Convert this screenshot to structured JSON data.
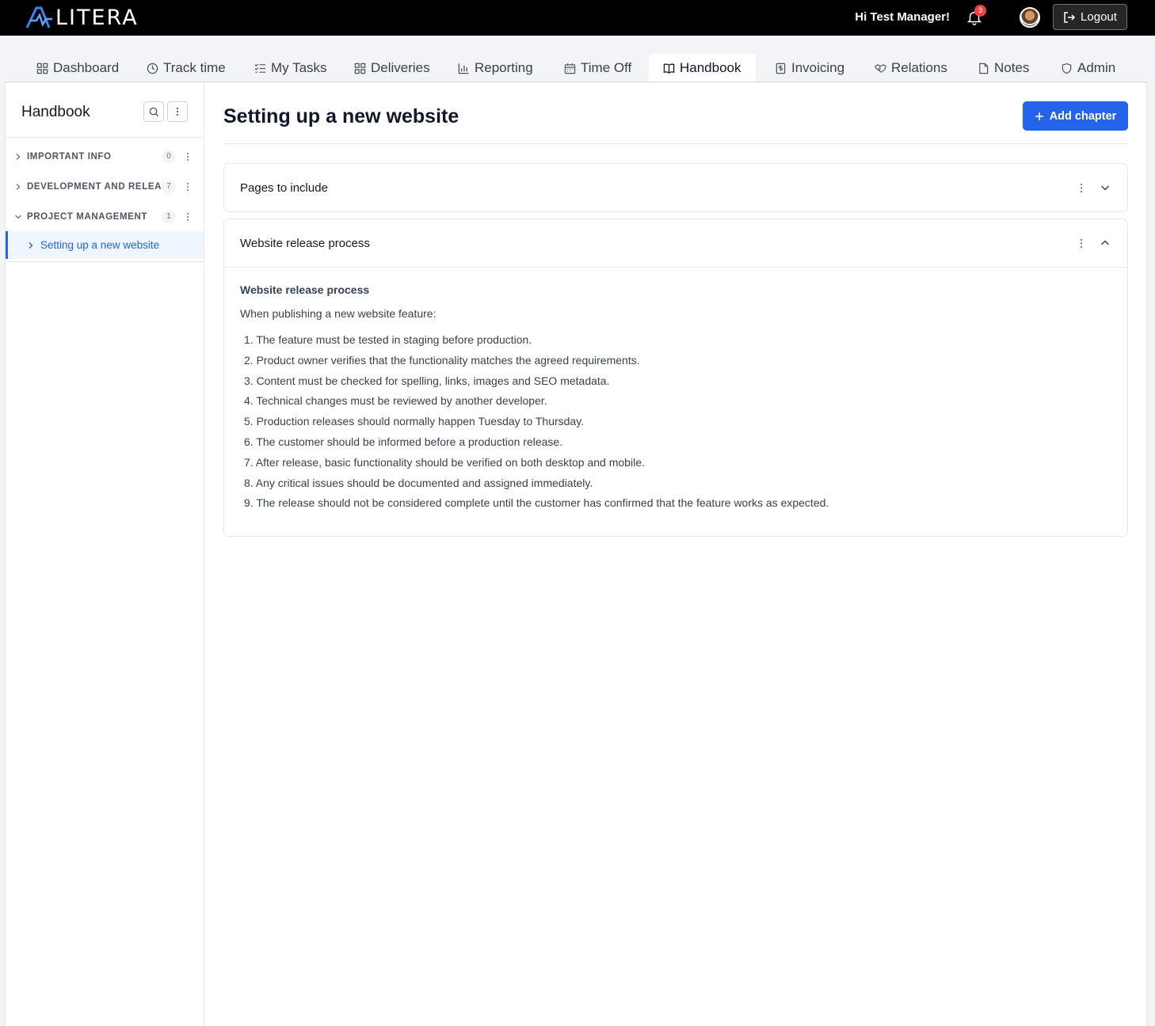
{
  "app": {
    "logo_text": "LITERA"
  },
  "topbar": {
    "greeting": "Hi Test Manager!",
    "notification_count": "3",
    "logout_label": "Logout"
  },
  "nav": {
    "tabs": [
      {
        "label": "Dashboard",
        "icon": "grid-icon"
      },
      {
        "label": "Track time",
        "icon": "clock-icon"
      },
      {
        "label": "My Tasks",
        "icon": "checklist-icon"
      },
      {
        "label": "Deliveries",
        "icon": "grid-icon"
      },
      {
        "label": "Reporting",
        "icon": "bar-chart-icon"
      },
      {
        "label": "Time Off",
        "icon": "calendar-icon"
      },
      {
        "label": "Handbook",
        "icon": "book-icon",
        "active": true
      },
      {
        "label": "Invoicing",
        "icon": "invoice-icon"
      },
      {
        "label": "Relations",
        "icon": "handshake-icon"
      },
      {
        "label": "Notes",
        "icon": "note-icon"
      },
      {
        "label": "Admin",
        "icon": "shield-icon"
      }
    ]
  },
  "sidebar": {
    "title": "Handbook",
    "sections": [
      {
        "label": "IMPORTANT INFO",
        "count": "0",
        "expanded": false
      },
      {
        "label": "DEVELOPMENT AND RELEA...",
        "count": "7",
        "expanded": false
      },
      {
        "label": "PROJECT MANAGEMENT",
        "count": "1",
        "expanded": true
      }
    ],
    "active_item": "Setting up a new website"
  },
  "main": {
    "title": "Setting up a new website",
    "add_chapter_label": "Add chapter",
    "chapters": [
      {
        "title": "Pages to include",
        "expanded": false
      },
      {
        "title": "Website release process",
        "expanded": true,
        "body_heading": "Website release process",
        "body_intro": "When publishing a new website feature:",
        "steps": [
          "1. The feature must be tested in staging before production.",
          "2. Product owner verifies that the functionality matches the agreed requirements.",
          "3. Content must be checked for spelling, links, images and SEO metadata.",
          "4. Technical changes must be reviewed by another developer.",
          "5. Production releases should normally happen Tuesday to Thursday.",
          "6. The customer should be informed before a production release.",
          "7. After release, basic functionality should be verified on both desktop and mobile.",
          "8. Any critical issues should be documented and assigned immediately.",
          "9. The release should not be considered complete until the customer has confirmed that the feature works as expected."
        ]
      }
    ]
  },
  "colors": {
    "accent": "#2563eb",
    "topbar": "#000000",
    "badge": "#ef4444"
  }
}
